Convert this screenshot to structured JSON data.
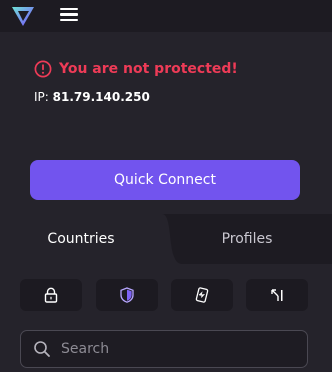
{
  "header": {
    "logo_icon": "vpn-triangle-logo-icon",
    "menu_icon": "hamburger-menu-icon"
  },
  "status": {
    "message": "You are not protected!",
    "ip_label": "IP:",
    "ip_value": "81.79.140.250",
    "warning_icon": "exclamation-circle-icon",
    "alert_color": "#ee3b57"
  },
  "quick_connect": {
    "label": "Quick Connect",
    "color": "#7254ee"
  },
  "tabs": [
    {
      "label": "Countries",
      "active": true
    },
    {
      "label": "Profiles",
      "active": false
    }
  ],
  "filters": [
    {
      "icon": "lock-icon",
      "selected": false
    },
    {
      "icon": "shield-icon",
      "selected": true
    },
    {
      "icon": "p2p-tag-icon",
      "selected": false
    },
    {
      "icon": "arrow-return-icon",
      "selected": false
    }
  ],
  "search": {
    "placeholder": "Search",
    "value": ""
  }
}
